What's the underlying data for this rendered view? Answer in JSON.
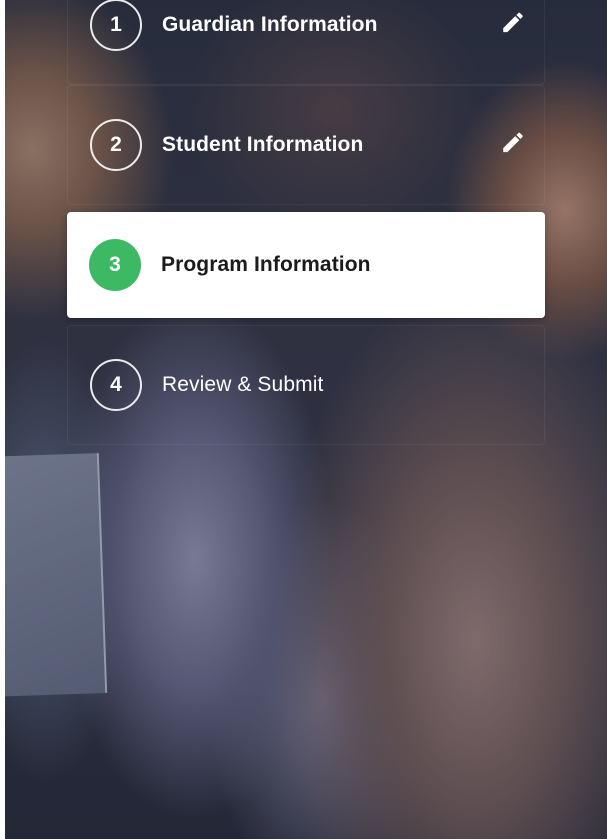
{
  "steps": [
    {
      "number": "1",
      "label": "Guardian Information",
      "state": "completed",
      "editable": true,
      "edit_icon": "pencil-icon"
    },
    {
      "number": "2",
      "label": "Student Information",
      "state": "completed",
      "editable": true,
      "edit_icon": "pencil-icon"
    },
    {
      "number": "3",
      "label": "Program Information",
      "state": "active",
      "editable": false
    },
    {
      "number": "4",
      "label": "Review & Submit",
      "state": "pending",
      "editable": false
    }
  ],
  "colors": {
    "active_badge": "#3db964",
    "active_card": "#ffffff",
    "text_light": "#ffffff",
    "text_dark": "#1b1b1b"
  }
}
